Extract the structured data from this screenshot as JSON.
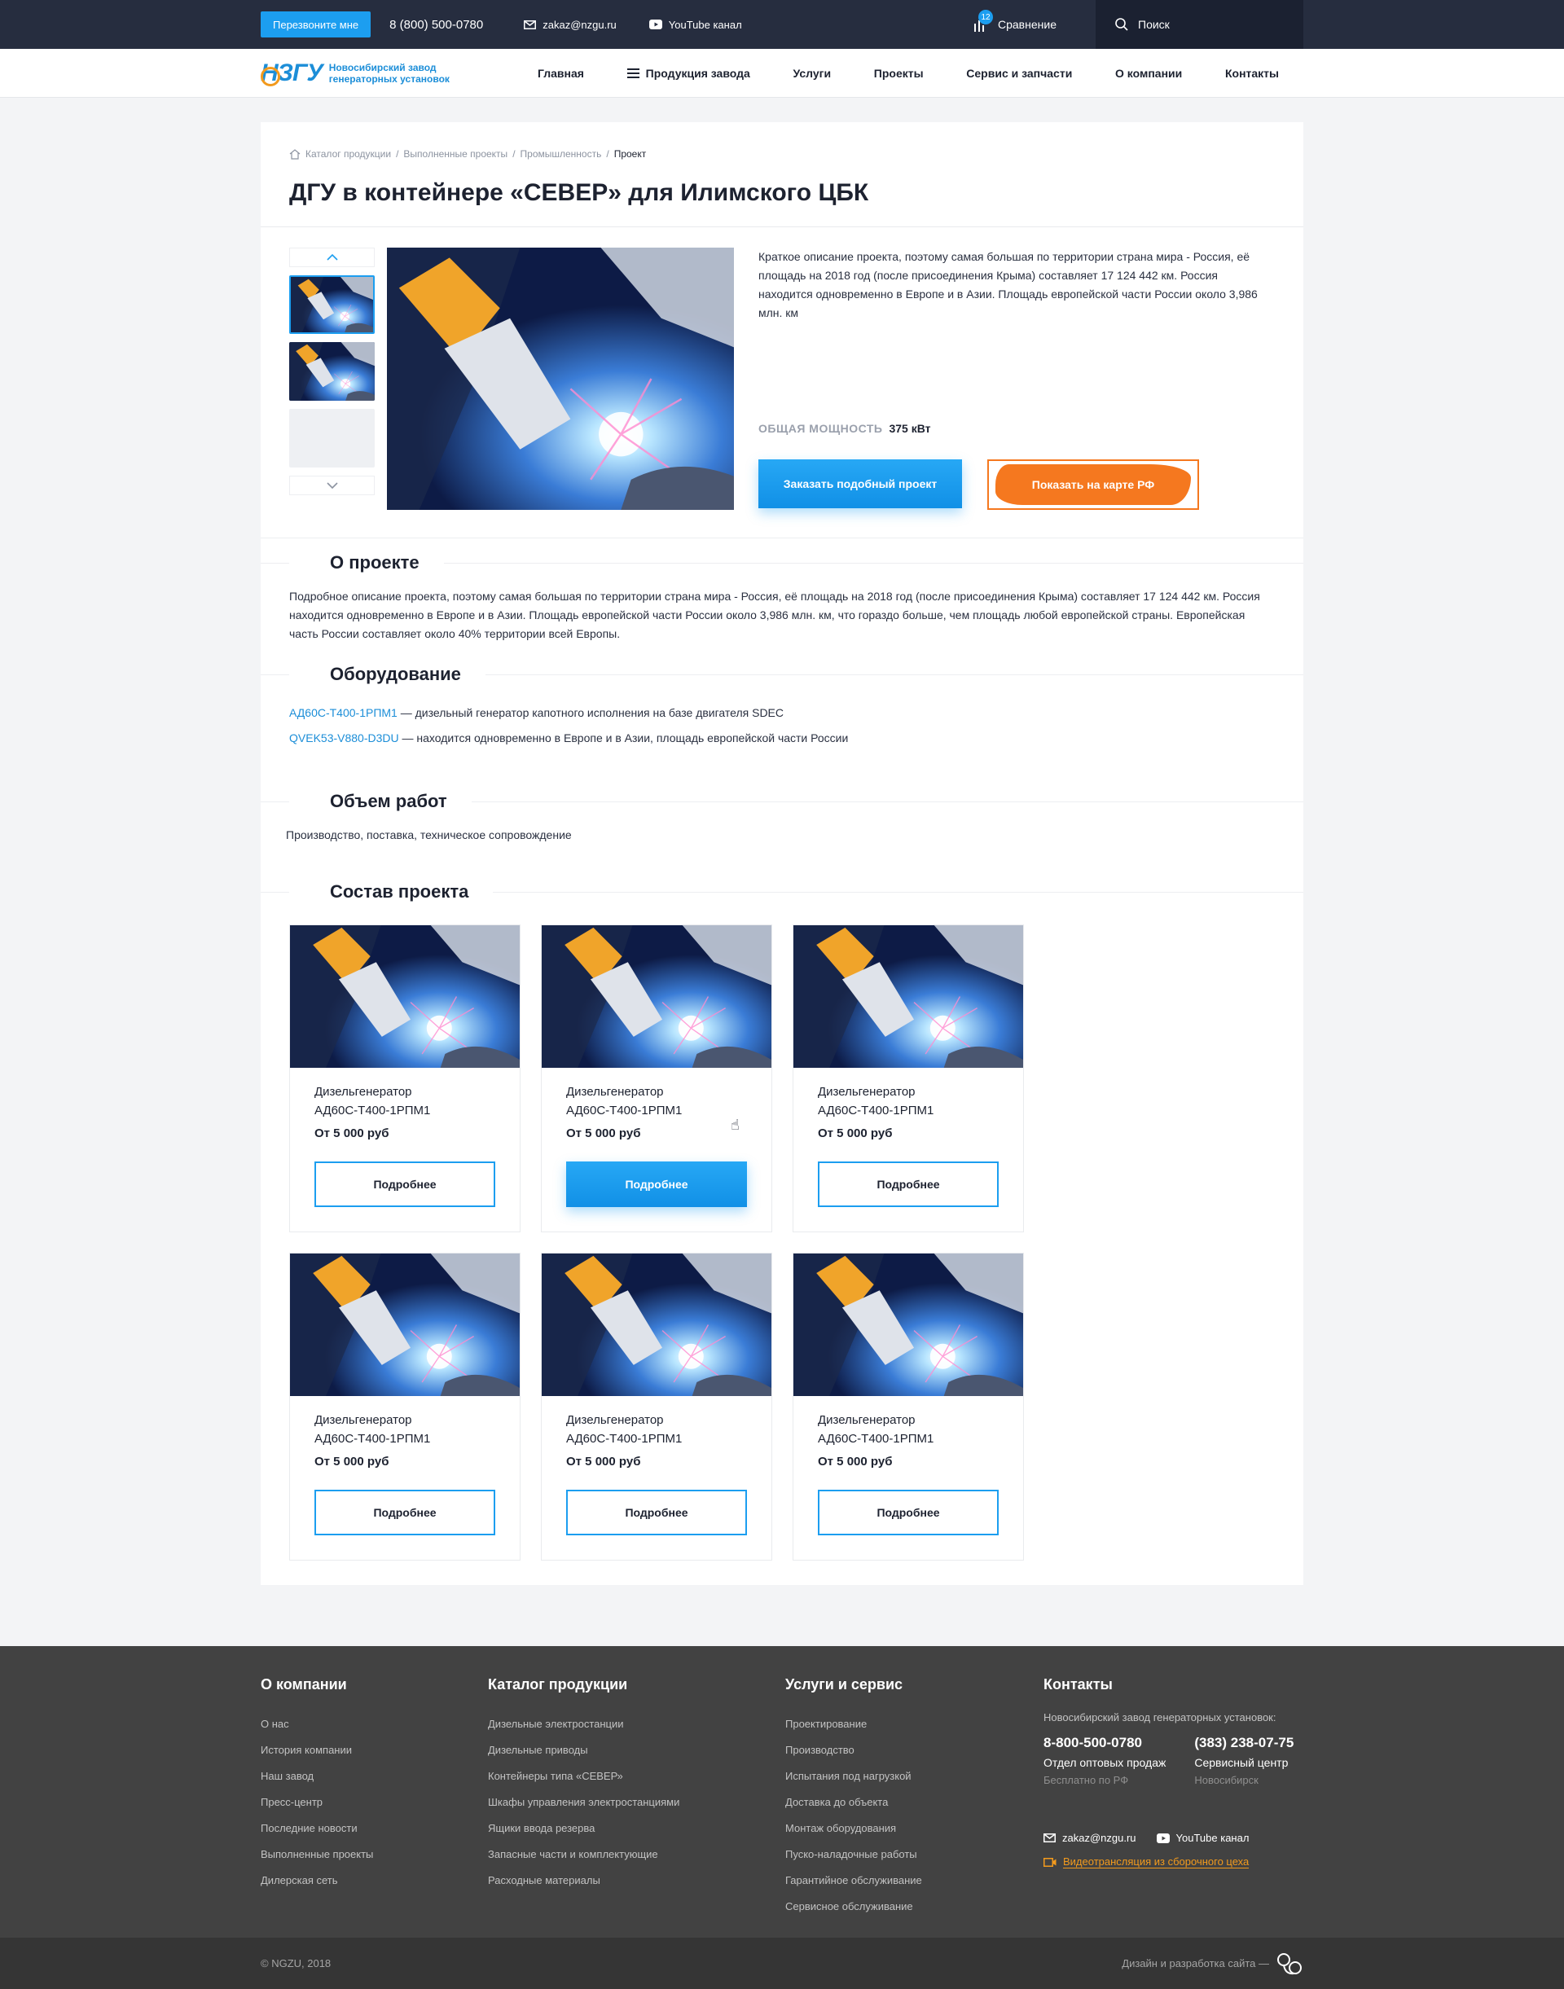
{
  "topbar": {
    "callback_label": "Перезвоните мне",
    "phone": "8 (800) 500-0780",
    "email": "zakaz@nzgu.ru",
    "youtube": "YouTube канал",
    "compare_label": "Сравнение",
    "compare_count": "12",
    "search_label": "Поиск"
  },
  "logo": {
    "mark": "НЗГУ",
    "line1": "Новосибирский завод",
    "line2": "генераторных установок"
  },
  "nav": [
    "Главная",
    "Продукция завода",
    "Услуги",
    "Проекты",
    "Сервис и запчасти",
    "О компании",
    "Контакты"
  ],
  "breadcrumbs": [
    "Каталог продукции",
    "Выполненные проекты",
    "Промышленность",
    "Проект"
  ],
  "title": "ДГУ в контейнере «СЕВЕР» для Илимского ЦБК",
  "project": {
    "short_description": "Краткое описание проекта, поэтому самая большая по территории страна мира - Россия, её площадь на 2018 год (после присоединения Крыма) составляет 17 124 442 км. Россия находится одновременно в Европе и в Азии. Площадь европейской части России около 3,986 млн. км",
    "power_label": "ОБЩАЯ МОЩНОСТЬ",
    "power_value": "375 кВт",
    "order_button": "Заказать подобный проект",
    "map_button": "Показать на карте РФ"
  },
  "about": {
    "title": "О проекте",
    "text": "Подробное описание проекта, поэтому самая большая по территории страна мира - Россия, её площадь на 2018 год (после присоединения Крыма) составляет 17 124 442 км. Россия находится одновременно в Европе и в Азии. Площадь европейской части России около 3,986 млн. км, что гораздо больше, чем площадь любой европейской страны. Европейская часть России составляет около 40% территории всей Европы."
  },
  "equipment": {
    "title": "Оборудование",
    "items": [
      {
        "link": "АД60С-Т400-1РПМ1",
        "text": " — дизельный генератор капотного исполнения на базе двигателя SDEC"
      },
      {
        "link": "QVEK53-V880-D3DU",
        "text": " — находится одновременно в Европе и в Азии, площадь европейской части России"
      }
    ]
  },
  "scope": {
    "title": "Объем работ",
    "text": "Производство, поставка, техническое сопровождение"
  },
  "composition": {
    "title": "Состав проекта",
    "cards": [
      {
        "name1": "Дизельгенератор",
        "name2": "АД60С-Т400-1РПМ1",
        "price": "От 5 000 руб",
        "button": "Подробнее"
      },
      {
        "name1": "Дизельгенератор",
        "name2": "АД60С-Т400-1РПМ1",
        "price": "От 5 000 руб",
        "button": "Подробнее"
      },
      {
        "name1": "Дизельгенератор",
        "name2": "АД60С-Т400-1РПМ1",
        "price": "От 5 000 руб",
        "button": "Подробнее"
      },
      {
        "name1": "Дизельгенератор",
        "name2": "АД60С-Т400-1РПМ1",
        "price": "От 5 000 руб",
        "button": "Подробнее"
      },
      {
        "name1": "Дизельгенератор",
        "name2": "АД60С-Т400-1РПМ1",
        "price": "От 5 000 руб",
        "button": "Подробнее"
      },
      {
        "name1": "Дизельгенератор",
        "name2": "АД60С-Т400-1РПМ1",
        "price": "От 5 000 руб",
        "button": "Подробнее"
      }
    ]
  },
  "footer": {
    "about": {
      "title": "О компании",
      "items": [
        "О нас",
        "История компании",
        "Наш завод",
        "Пресс-центр",
        "Последние новости",
        "Выполненные проекты",
        "Дилерская сеть"
      ]
    },
    "catalog": {
      "title": "Каталог продукции",
      "items": [
        "Дизельные электростанции",
        "Дизельные приводы",
        "Контейнеры типа «СЕВЕР»",
        "Шкафы управления электростанциями",
        "Ящики ввода резерва",
        "Запасные части и комплектующие",
        "Расходные материалы"
      ]
    },
    "services": {
      "title": "Услуги и сервис",
      "items": [
        "Проектирование",
        "Производство",
        "Испытания под нагрузкой",
        "Доставка до объекта",
        "Монтаж оборудования",
        "Пуско-наладочные работы",
        "Гарантийное обслуживание",
        "Сервисное обслуживание"
      ]
    },
    "contacts": {
      "title": "Контакты",
      "lead": "Новосибирский завод генераторных установок:",
      "phone1": "8-800-500-0780",
      "phone1_label": "Отдел оптовых продаж",
      "phone1_note": "Бесплатно по РФ",
      "phone2": "(383) 238-07-75",
      "phone2_label": "Сервисный центр",
      "phone2_note": "Новосибирск",
      "email": "zakaz@nzgu.ru",
      "youtube": "YouTube канал",
      "video": "Видеотрансляция из сборочного цеха"
    },
    "copyright": "© NGZU, 2018",
    "dev_label": "Дизайн и разработка сайта —"
  },
  "colors": {
    "accent": "#1c9ef0",
    "orange": "#f5781f",
    "topbar": "#262d3f",
    "footer": "#424242"
  }
}
